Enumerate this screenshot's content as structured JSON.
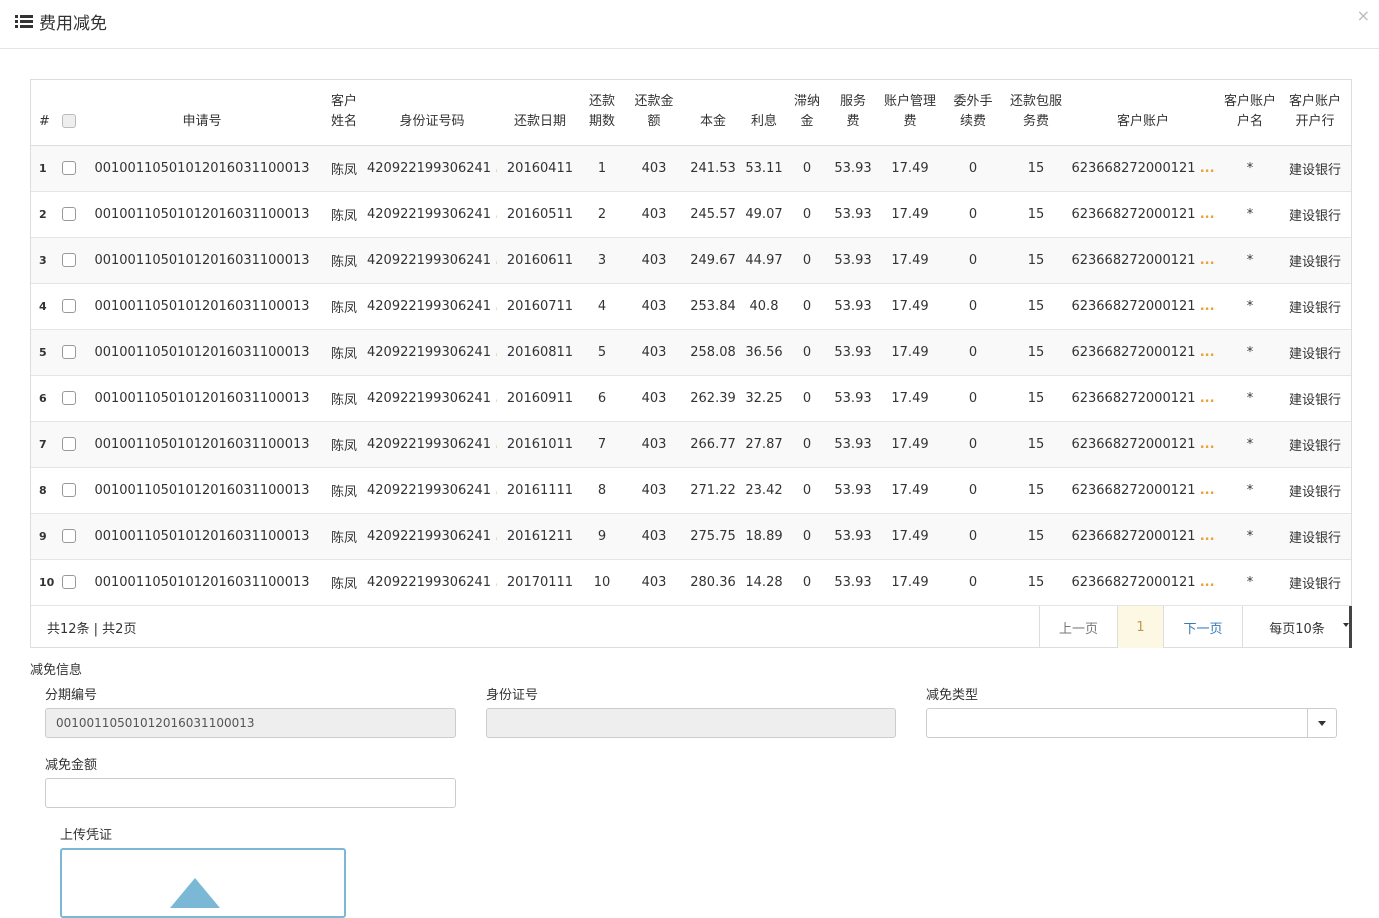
{
  "header": {
    "title": "费用减免",
    "close_label": "×"
  },
  "grid": {
    "columns": {
      "rownum": "#",
      "app_no": "申请号",
      "cust_name": [
        "客户",
        "姓名"
      ],
      "id_no": "身份证号码",
      "repay_date": "还款日期",
      "periods": [
        "还款",
        "期数"
      ],
      "amount": [
        "还款金",
        "额"
      ],
      "principal": "本金",
      "interest": "利息",
      "late_fee": [
        "滞纳",
        "金"
      ],
      "service_fee": [
        "服务",
        "费"
      ],
      "acct_fee": [
        "账户管理",
        "费"
      ],
      "outsource_fee": [
        "委外手",
        "续费"
      ],
      "package_fee": [
        "还款包服",
        "务费"
      ],
      "cust_acct": "客户账户",
      "acct_name": [
        "客户账户",
        "户名"
      ],
      "acct_bank": [
        "客户账户",
        "开户行"
      ]
    },
    "rows": [
      {
        "n": "1",
        "app": "0010011050101201603110001 3",
        "name": "陈凤",
        "id": "420922199306241",
        "date": "20160411",
        "per": "1",
        "amt": "403",
        "prin": "241.53",
        "int": "53.11",
        "late": "0",
        "svc": "53.93",
        "acct": "17.49",
        "out": "0",
        "pkg": "15",
        "card": "623668272000121",
        "aname": "*",
        "bank": "建设银行"
      },
      {
        "n": "2",
        "app": "00100110501012016031100013",
        "name": "陈凤",
        "id": "420922199306241",
        "date": "20160511",
        "per": "2",
        "amt": "403",
        "prin": "245.57",
        "int": "49.07",
        "late": "0",
        "svc": "53.93",
        "acct": "17.49",
        "out": "0",
        "pkg": "15",
        "card": "623668272000121",
        "aname": "*",
        "bank": "建设银行"
      },
      {
        "n": "3",
        "app": "00100110501012016031100013",
        "name": "陈凤",
        "id": "420922199306241",
        "date": "20160611",
        "per": "3",
        "amt": "403",
        "prin": "249.67",
        "int": "44.97",
        "late": "0",
        "svc": "53.93",
        "acct": "17.49",
        "out": "0",
        "pkg": "15",
        "card": "623668272000121",
        "aname": "*",
        "bank": "建设银行"
      },
      {
        "n": "4",
        "app": "00100110501012016031100013",
        "name": "陈凤",
        "id": "420922199306241",
        "date": "20160711",
        "per": "4",
        "amt": "403",
        "prin": "253.84",
        "int": "40.8",
        "late": "0",
        "svc": "53.93",
        "acct": "17.49",
        "out": "0",
        "pkg": "15",
        "card": "623668272000121",
        "aname": "*",
        "bank": "建设银行"
      },
      {
        "n": "5",
        "app": "00100110501012016031100013",
        "name": "陈凤",
        "id": "420922199306241",
        "date": "20160811",
        "per": "5",
        "amt": "403",
        "prin": "258.08",
        "int": "36.56",
        "late": "0",
        "svc": "53.93",
        "acct": "17.49",
        "out": "0",
        "pkg": "15",
        "card": "623668272000121",
        "aname": "*",
        "bank": "建设银行"
      },
      {
        "n": "6",
        "app": "00100110501012016031100013",
        "name": "陈凤",
        "id": "420922199306241",
        "date": "20160911",
        "per": "6",
        "amt": "403",
        "prin": "262.39",
        "int": "32.25",
        "late": "0",
        "svc": "53.93",
        "acct": "17.49",
        "out": "0",
        "pkg": "15",
        "card": "623668272000121",
        "aname": "*",
        "bank": "建设银行"
      },
      {
        "n": "7",
        "app": "00100110501012016031100013",
        "name": "陈凤",
        "id": "420922199306241",
        "date": "20161011",
        "per": "7",
        "amt": "403",
        "prin": "266.77",
        "int": "27.87",
        "late": "0",
        "svc": "53.93",
        "acct": "17.49",
        "out": "0",
        "pkg": "15",
        "card": "623668272000121",
        "aname": "*",
        "bank": "建设银行"
      },
      {
        "n": "8",
        "app": "00100110501012016031100013",
        "name": "陈凤",
        "id": "420922199306241",
        "date": "20161111",
        "per": "8",
        "amt": "403",
        "prin": "271.22",
        "int": "23.42",
        "late": "0",
        "svc": "53.93",
        "acct": "17.49",
        "out": "0",
        "pkg": "15",
        "card": "623668272000121",
        "aname": "*",
        "bank": "建设银行"
      },
      {
        "n": "9",
        "app": "00100110501012016031100013",
        "name": "陈凤",
        "id": "420922199306241",
        "date": "20161211",
        "per": "9",
        "amt": "403",
        "prin": "275.75",
        "int": "18.89",
        "late": "0",
        "svc": "53.93",
        "acct": "17.49",
        "out": "0",
        "pkg": "15",
        "card": "623668272000121",
        "aname": "*",
        "bank": "建设银行"
      },
      {
        "n": "10",
        "app": "00100110501012016031100013",
        "name": "陈凤",
        "id": "420922199306241",
        "date": "20170111",
        "per": "10",
        "amt": "403",
        "prin": "280.36",
        "int": "14.28",
        "late": "0",
        "svc": "53.93",
        "acct": "17.49",
        "out": "0",
        "pkg": "15",
        "card": "623668272000121",
        "aname": "*",
        "bank": "建设银行"
      }
    ],
    "ellipsis": "..."
  },
  "pager": {
    "info": "共12条 | 共2页",
    "prev": "上一页",
    "current": "1",
    "next": "下一页",
    "page_size": "每页10条"
  },
  "form": {
    "section_title": "减免信息",
    "installment_label": "分期编号",
    "installment_value": "00100110501012016031100013",
    "id_label": "身份证号",
    "id_value": "",
    "type_label": "减免类型",
    "type_value": "",
    "amount_label": "减免金额",
    "amount_value": "",
    "upload_label": "上传凭证"
  },
  "colors": {
    "accent": "#337ab7",
    "ellipsis": "#f0a030",
    "upload_border": "#7ab8d6"
  }
}
